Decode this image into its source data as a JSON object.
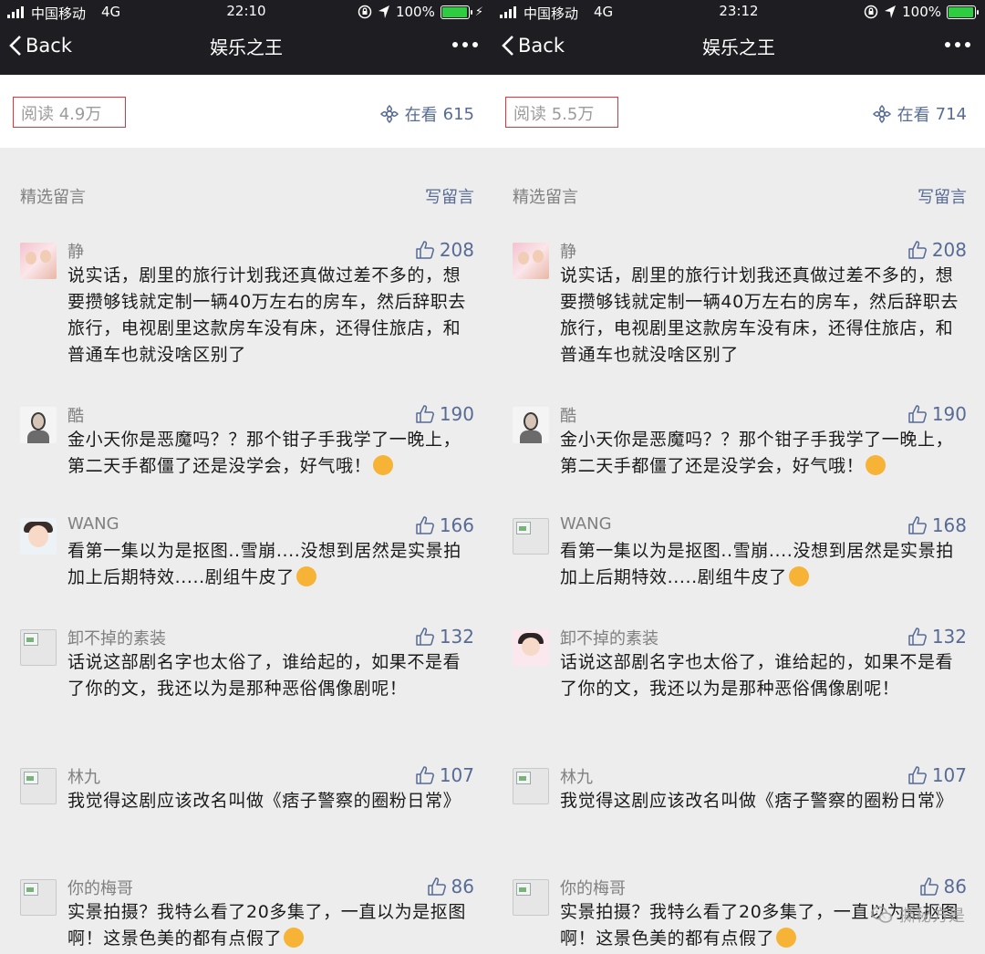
{
  "panels": [
    {
      "status": {
        "carrier": "中国移动",
        "network": "4G",
        "time": "22:10",
        "battery": "100%"
      },
      "nav": {
        "back_label": "Back",
        "title": "娱乐之王"
      },
      "stats": {
        "reads": "阅读 4.9万",
        "watching_label": "在看",
        "watching_count": "615"
      },
      "comments_header": {
        "title": "精选留言",
        "write_label": "写留言"
      },
      "comments": [
        {
          "name": "静",
          "likes": "208",
          "text": "说实话，剧里的旅行计划我还真做过差不多的，想要攒够钱就定制一辆40万左右的房车，然后辞职去旅行，电视剧里这款房车没有床，还得住旅店，和普通车也就没啥区别了"
        },
        {
          "name": "酷",
          "likes": "190",
          "text": "金小天你是恶魔吗？？那个钳子手我学了一晚上，第二天手都僵了还是没学会，好气哦！"
        },
        {
          "name": "WANG",
          "likes": "166",
          "text": "看第一集以为是抠图..雪崩....没想到居然是实景拍加上后期特效.....剧组牛皮了"
        },
        {
          "name": "卸不掉的素装",
          "likes": "132",
          "text": "话说这部剧名字也太俗了，谁给起的，如果不是看了你的文，我还以为是那种恶俗偶像剧呢！"
        },
        {
          "name": "林九",
          "likes": "107",
          "text": "我觉得这剧应该改名叫做《痞子警察的圈粉日常》"
        },
        {
          "name": "你的梅哥",
          "likes": "86",
          "text": "实景拍摄？我特么看了20多集了，一直以为是抠图啊！这景色美的都有点假了"
        }
      ]
    },
    {
      "status": {
        "carrier": "中国移动",
        "network": "4G",
        "time": "23:12",
        "battery": "100%"
      },
      "nav": {
        "back_label": "Back",
        "title": "娱乐之王"
      },
      "stats": {
        "reads": "阅读 5.5万",
        "watching_label": "在看",
        "watching_count": "714"
      },
      "comments_header": {
        "title": "精选留言",
        "write_label": "写留言"
      },
      "comments": [
        {
          "name": "静",
          "likes": "208",
          "text": "说实话，剧里的旅行计划我还真做过差不多的，想要攒够钱就定制一辆40万左右的房车，然后辞职去旅行，电视剧里这款房车没有床，还得住旅店，和普通车也就没啥区别了"
        },
        {
          "name": "酷",
          "likes": "190",
          "text": "金小天你是恶魔吗？？那个钳子手我学了一晚上，第二天手都僵了还是没学会，好气哦！"
        },
        {
          "name": "WANG",
          "likes": "168",
          "text": "看第一集以为是抠图..雪崩....没想到居然是实景拍加上后期特效.....剧组牛皮了"
        },
        {
          "name": "卸不掉的素装",
          "likes": "132",
          "text": "话说这部剧名字也太俗了，谁给起的，如果不是看了你的文，我还以为是那种恶俗偶像剧呢！"
        },
        {
          "name": "林九",
          "likes": "107",
          "text": "我觉得这剧应该改名叫做《痞子警察的圈粉日常》"
        },
        {
          "name": "你的梅哥",
          "likes": "86",
          "text": "实景拍摄？我特么看了20多集了，一直以为是抠图啊！这景色美的都有点假了"
        }
      ],
      "watermark": "撕秘方是"
    }
  ],
  "colors": {
    "nav_bg": "#1e1e22",
    "link": "#576b95",
    "highlight_box": "#d9363e",
    "battery": "#2ecc40"
  }
}
